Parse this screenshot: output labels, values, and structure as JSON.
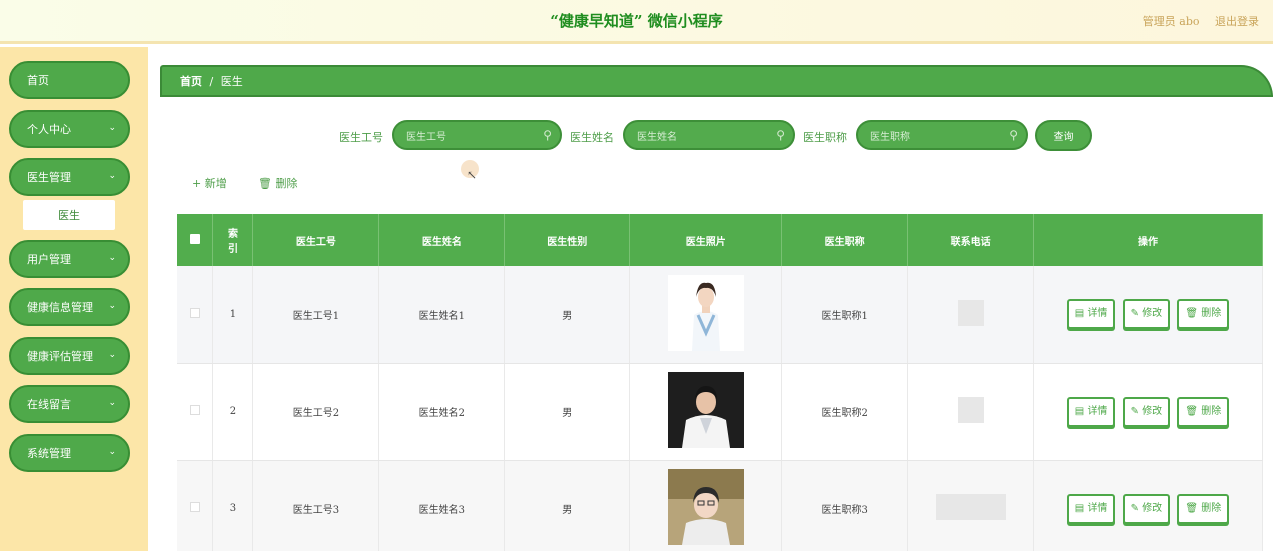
{
  "header": {
    "title": "“健康早知道” 微信小程序",
    "admin_label": "管理员 abo",
    "logout": "退出登录"
  },
  "sidebar": {
    "items": [
      {
        "label": "首页",
        "expandable": false
      },
      {
        "label": "个人中心",
        "expandable": true
      },
      {
        "label": "医生管理",
        "expandable": true
      },
      {
        "label": "用户管理",
        "expandable": true
      },
      {
        "label": "健康信息管理",
        "expandable": true
      },
      {
        "label": "健康评估管理",
        "expandable": true
      },
      {
        "label": "在线留言",
        "expandable": true
      },
      {
        "label": "系统管理",
        "expandable": true
      }
    ],
    "submenu_active": "医生"
  },
  "breadcrumb": {
    "home": "首页",
    "separator": "/",
    "current": "医生"
  },
  "search": {
    "fields": [
      {
        "label": "医生工号",
        "placeholder": "医生工号"
      },
      {
        "label": "医生姓名",
        "placeholder": "医生姓名"
      },
      {
        "label": "医生职称",
        "placeholder": "医生职称"
      }
    ],
    "query_button": "查询"
  },
  "actions": {
    "add": "新增",
    "delete": "删除"
  },
  "table": {
    "headers": [
      "索引",
      "医生工号",
      "医生姓名",
      "医生性别",
      "医生照片",
      "医生职称",
      "联系电话",
      "操作"
    ],
    "rows": [
      {
        "index": "1",
        "id": "医生工号1",
        "name": "医生姓名1",
        "gender": "男",
        "title": "医生职称1"
      },
      {
        "index": "2",
        "id": "医生工号2",
        "name": "医生姓名2",
        "gender": "男",
        "title": "医生职称2"
      },
      {
        "index": "3",
        "id": "医生工号3",
        "name": "医生姓名3",
        "gender": "男",
        "title": "医生职称3"
      }
    ],
    "row_buttons": {
      "detail": "详情",
      "edit": "修改",
      "delete": "删除"
    }
  },
  "colors": {
    "primary_green": "#4fa94a",
    "sidebar_bg": "#fce6a8",
    "title_green": "#1f8d1f"
  }
}
